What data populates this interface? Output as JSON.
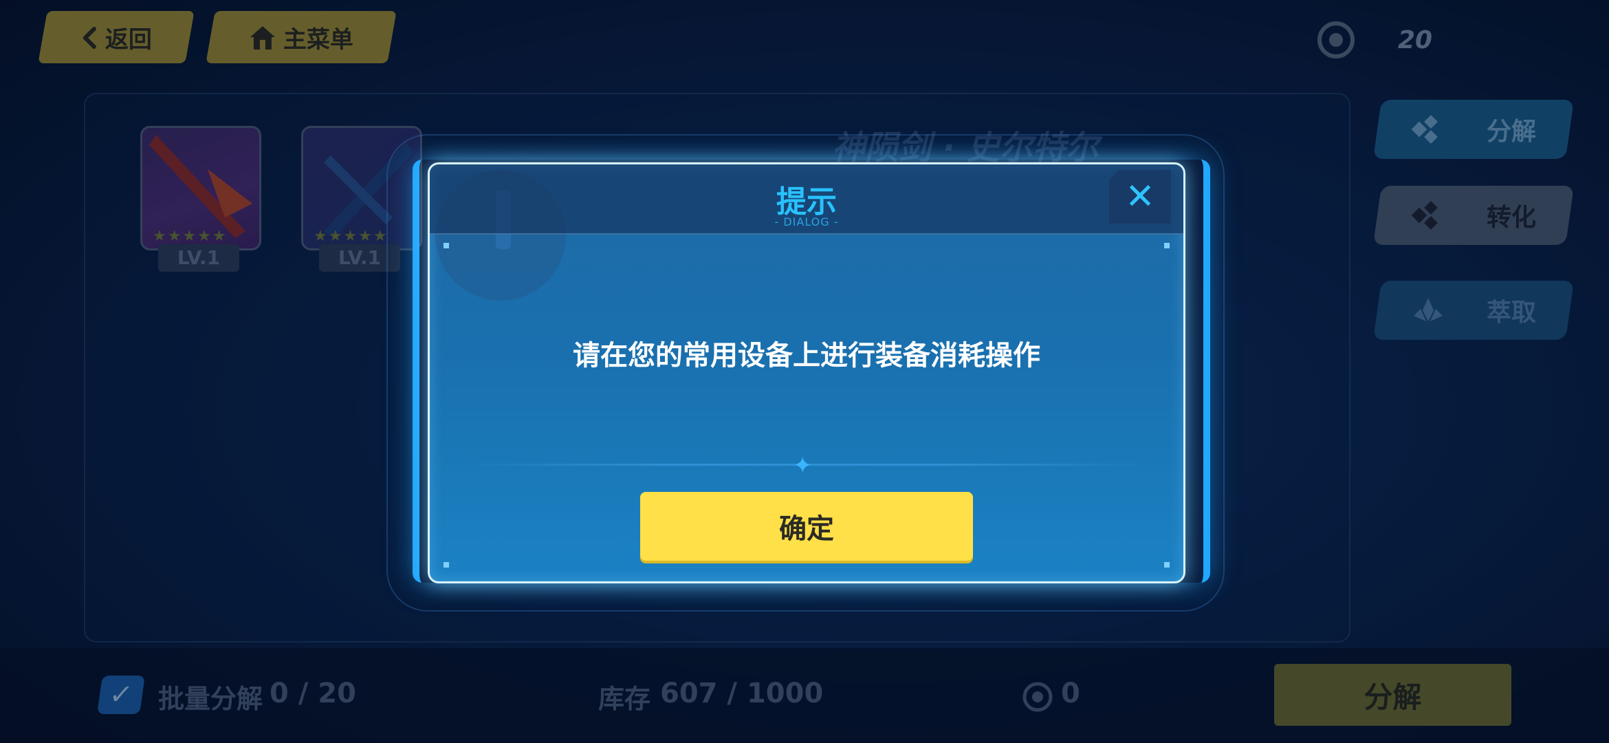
{
  "top_bar": {
    "back_label": "返回",
    "menu_label": "主菜单",
    "currency_value": "20"
  },
  "items": [
    {
      "level": "LV.1",
      "stars": "★★★★★"
    },
    {
      "level": "LV.1",
      "stars": "★★★★★"
    }
  ],
  "weapon_name": "神陨剑 · 史尔特尔",
  "side_tabs": {
    "decompose_label": "分解",
    "convert_label": "转化",
    "extract_label": "萃取"
  },
  "bottom": {
    "bulk_label": "批量分解",
    "bulk_count": "0 / 20",
    "stock_label": "库存",
    "stock_value": "607 / 1000",
    "reward_value": "0",
    "decompose_button": "分解"
  },
  "dialog": {
    "title": "提示",
    "subtitle": "- DIALOG -",
    "close_icon": "✕",
    "message": "请在您的常用设备上进行装备消耗操作",
    "confirm_label": "确定"
  },
  "colors": {
    "accent": "#21a8ff",
    "confirm": "#ffe048",
    "title": "#29c2ff"
  }
}
